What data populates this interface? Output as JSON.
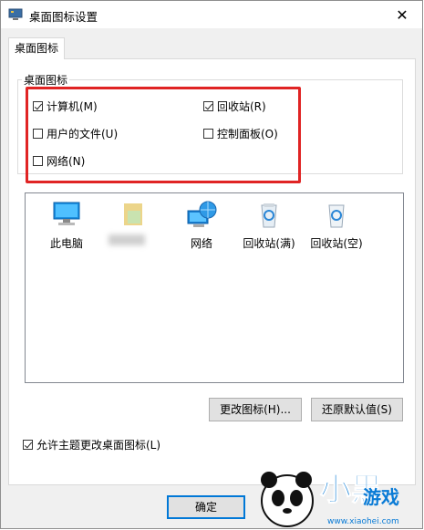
{
  "window": {
    "title": "桌面图标设置",
    "close_glyph": "✕"
  },
  "tab": {
    "label": "桌面图标"
  },
  "group": {
    "title": "桌面图标",
    "checkboxes": [
      {
        "label": "计算机(M)",
        "checked": true
      },
      {
        "label": "回收站(R)",
        "checked": true
      },
      {
        "label": "用户的文件(U)",
        "checked": false
      },
      {
        "label": "控制面板(O)",
        "checked": false
      },
      {
        "label": "网络(N)",
        "checked": false
      }
    ]
  },
  "icons": [
    {
      "label": "此电脑",
      "icon": "computer-icon"
    },
    {
      "label": "",
      "icon": "user-folder-icon"
    },
    {
      "label": "网络",
      "icon": "network-icon"
    },
    {
      "label": "回收站(满)",
      "icon": "recycle-bin-full-icon"
    },
    {
      "label": "回收站(空)",
      "icon": "recycle-bin-empty-icon"
    }
  ],
  "buttons": {
    "change_icon": "更改图标(H)...",
    "restore_default": "还原默认值(S)",
    "ok": "确定"
  },
  "theme_checkbox": {
    "label": "允许主题更改桌面图标(L)",
    "checked": true
  },
  "watermark": {
    "text": "小黑游戏",
    "url": "www.xiaohei.com"
  },
  "colors": {
    "highlight": "#e02424",
    "accent": "#0078d7"
  }
}
